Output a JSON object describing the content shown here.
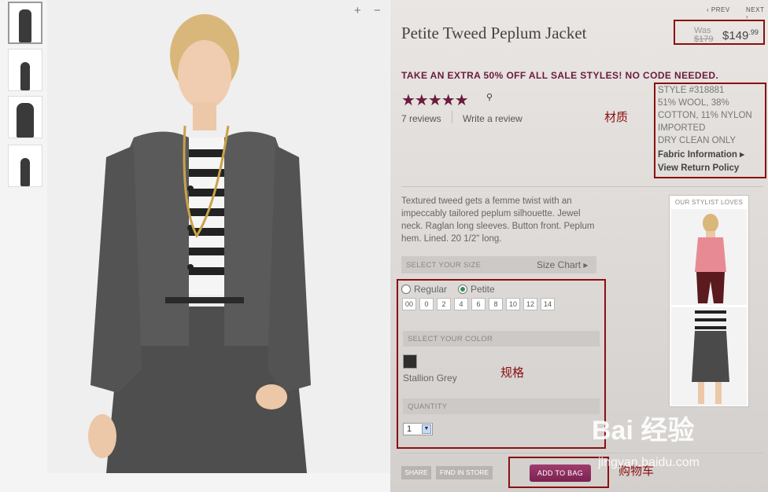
{
  "nav": {
    "prev": "PREV",
    "next": "NEXT"
  },
  "gallery": {
    "zoom_in": "+",
    "zoom_out": "−",
    "thumbnails": [
      "outfit-front",
      "skirt-front",
      "jacket-side",
      "outfit-full"
    ]
  },
  "product": {
    "title": "Petite Tweed Peplum Jacket",
    "was_label": "Was",
    "was_price": "$179",
    "sale_price": "$149",
    "sale_cents": ".99",
    "promo": "TAKE AN EXTRA 50% OFF ALL SALE STYLES! NO CODE NEEDED.",
    "rating": 4.5,
    "stars": "★★★★★",
    "reviews_count": "7 reviews",
    "write_review": "Write a review"
  },
  "details": {
    "style": "STYLE #318881",
    "material_1": "51% WOOL, 38%",
    "material_2": "COTTON, 11% NYLON",
    "origin": "IMPORTED",
    "care": "DRY CLEAN ONLY",
    "fabric_link": "Fabric Information ▸",
    "return_link": "View Return Policy"
  },
  "description": "Textured tweed gets a femme twist with an impeccably tailored peplum silhouette. Jewel neck. Raglan long sleeves. Button front. Peplum hem. Lined. 20 1/2\" long.",
  "size": {
    "header": "SELECT YOUR SIZE",
    "chart_link": "Size Chart ▸",
    "fit_options": [
      {
        "label": "Regular",
        "selected": false
      },
      {
        "label": "Petite",
        "selected": true
      }
    ],
    "sizes": [
      "00",
      "0",
      "2",
      "4",
      "6",
      "8",
      "10",
      "12",
      "14"
    ]
  },
  "color": {
    "header": "SELECT YOUR COLOR",
    "name": "Stallion Grey",
    "swatch": "#2e2e2e"
  },
  "quantity": {
    "header": "QUANTITY",
    "value": "1"
  },
  "actions": {
    "share": "SHARE",
    "find_in_store": "FIND IN STORE",
    "add_to_bag": "ADD TO BAG"
  },
  "stylist": {
    "title": "OUR STYLIST LOVES"
  },
  "annotations": {
    "material": "材质",
    "spec": "规格",
    "cart": "购物车"
  },
  "watermark": {
    "logo": "Bai 经验",
    "url": "jingyan.baidu.com"
  },
  "colors": {
    "accent": "#6b1a3e",
    "annotation": "#8a1010",
    "button": "#7a2150"
  }
}
